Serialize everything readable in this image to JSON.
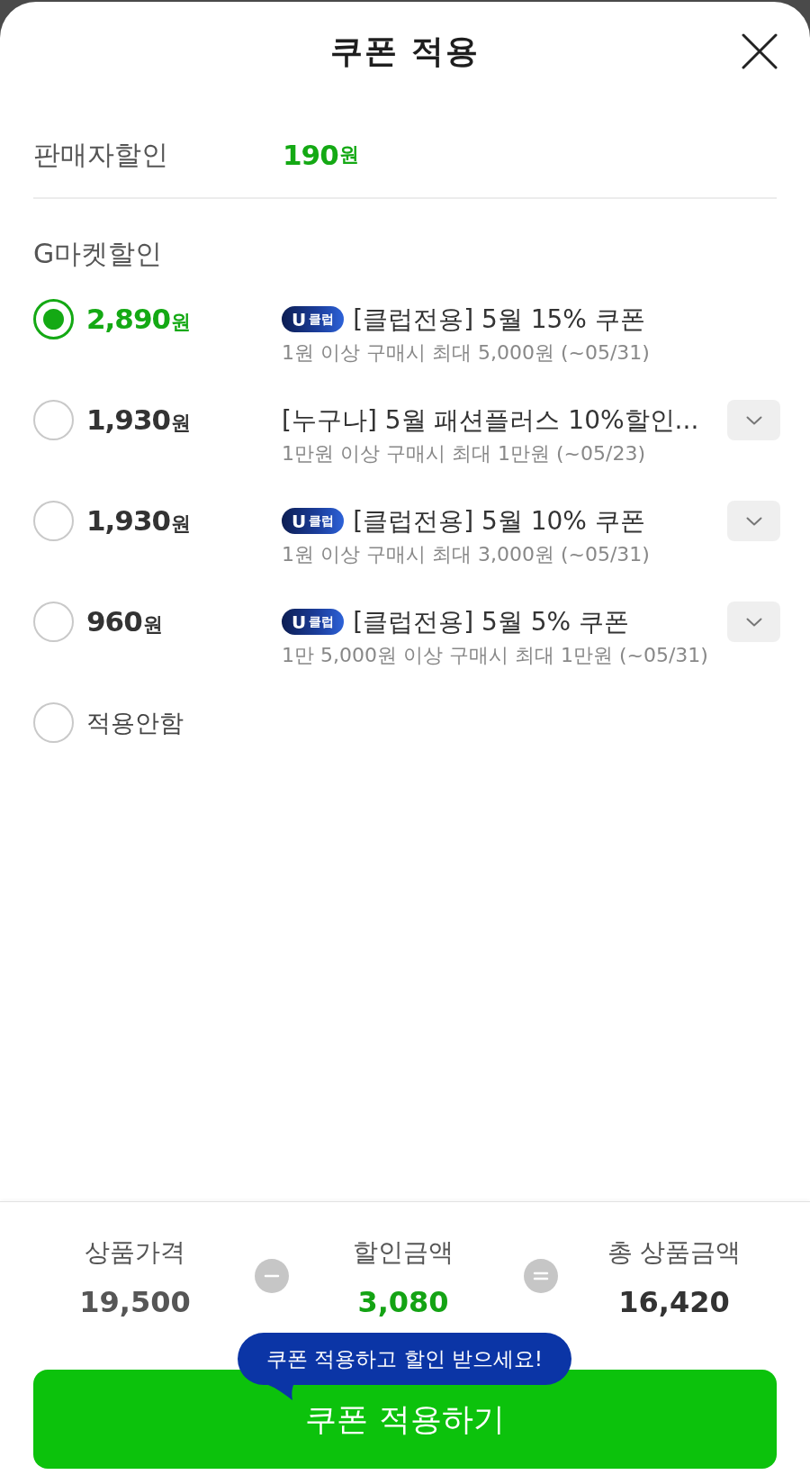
{
  "header": {
    "title": "쿠폰 적용"
  },
  "seller_discount": {
    "label": "판매자할인",
    "amount": "190",
    "unit": "원"
  },
  "gmarket_discount": {
    "label": "G마켓할인",
    "options": [
      {
        "kind": "coupon",
        "selected": true,
        "amount": "2,890",
        "unit": "원",
        "badge": "**U**클럽",
        "title": "[클럽전용] 5월 15% 쿠폰",
        "condition": "1원 이상 구매시 최대 5,000원 (~05/31)",
        "expandable": false
      },
      {
        "kind": "coupon",
        "selected": false,
        "amount": "1,930",
        "unit": "원",
        "title": "[누구나] 5월 패션플러스 10%할인...",
        "condition": "1만원 이상 구매시 최대 1만원 (~05/23)",
        "expandable": true
      },
      {
        "kind": "coupon",
        "selected": false,
        "amount": "1,930",
        "unit": "원",
        "badge": "**U**클럽",
        "title": "[클럽전용] 5월 10% 쿠폰",
        "condition": "1원 이상 구매시 최대 3,000원 (~05/31)",
        "expandable": true
      },
      {
        "kind": "coupon",
        "selected": false,
        "amount": "960",
        "unit": "원",
        "badge": "**U**클럽",
        "title": "[클럽전용] 5월 5% 쿠폰",
        "condition": "1만 5,000원 이상 구매시 최대 1만원 (~05/31)",
        "expandable": true
      },
      {
        "kind": "none",
        "selected": false,
        "label": "적용안함"
      }
    ]
  },
  "summary": {
    "items": [
      {
        "kind": "price",
        "label": "상품가격",
        "value": "19,500"
      },
      {
        "kind": "discount",
        "label": "할인금액",
        "value": "3,080"
      },
      {
        "kind": "total",
        "label": "총 상품금액",
        "value": "16,420"
      }
    ]
  },
  "tooltip": "쿠폰 적용하고 할인 받으세요!",
  "apply_button": "쿠폰 적용하기"
}
